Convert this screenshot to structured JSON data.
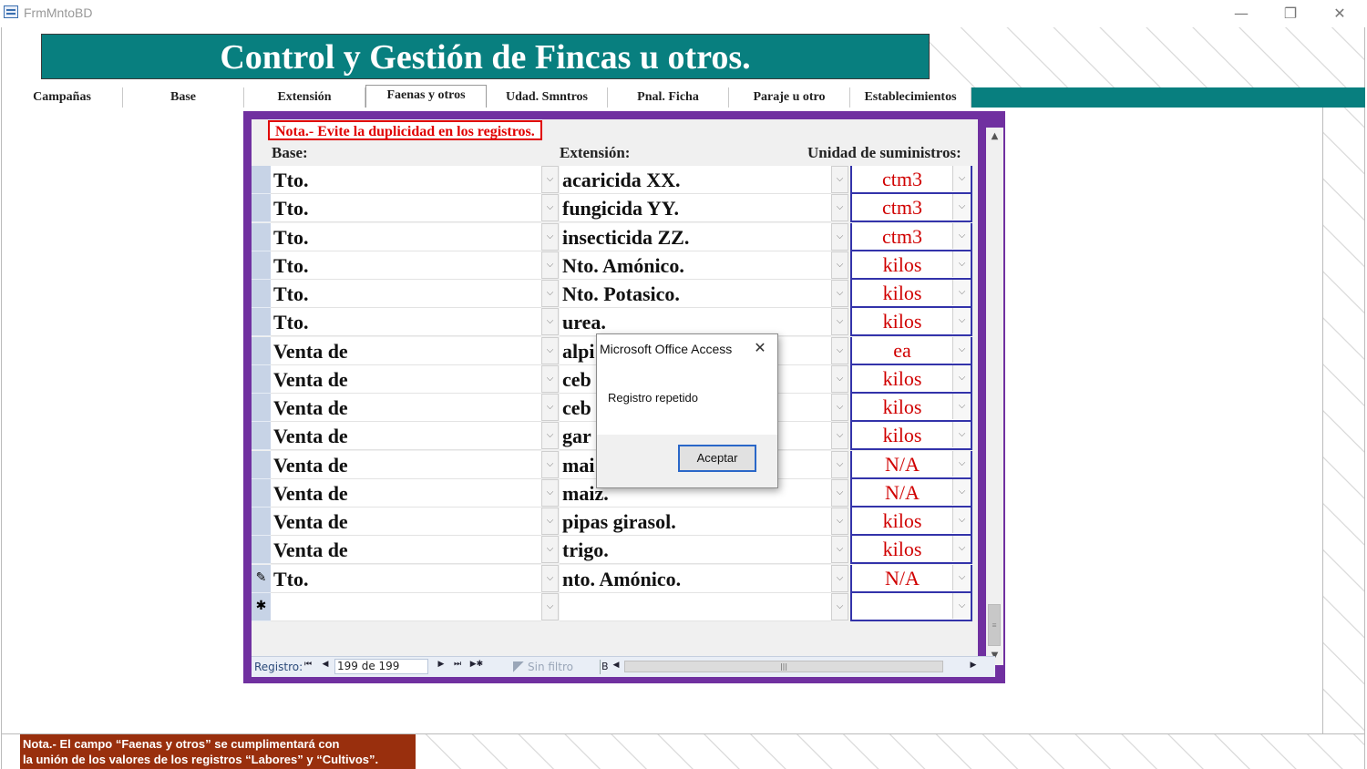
{
  "window": {
    "title": "FrmMntoBD",
    "minimize_glyph": "—",
    "restore_glyph": "❐",
    "close_glyph": "✕"
  },
  "header": {
    "title": "Control y Gestión de Fincas u otros."
  },
  "tabs": [
    {
      "label": "Campañas",
      "active": false
    },
    {
      "label": "Base",
      "active": false
    },
    {
      "label": "Extensión",
      "active": false
    },
    {
      "label": "Faenas y otros",
      "active": true
    },
    {
      "label": "Udad. Smntros",
      "active": false
    },
    {
      "label": "Pnal. Ficha",
      "active": false
    },
    {
      "label": "Paraje u otro",
      "active": false
    },
    {
      "label": "Establecimientos",
      "active": false
    }
  ],
  "subform": {
    "note": "Nota.- Evite la duplicidad en los registros.",
    "headers": {
      "base": "Base:",
      "extension": "Extensión:",
      "unit": "Unidad de suministros:"
    },
    "rows": [
      {
        "base": "Tto.",
        "extension": "acaricida XX.",
        "unit": "ctm3",
        "selector": ""
      },
      {
        "base": "Tto.",
        "extension": "fungicida YY.",
        "unit": "ctm3",
        "selector": ""
      },
      {
        "base": "Tto.",
        "extension": "insecticida ZZ.",
        "unit": "ctm3",
        "selector": ""
      },
      {
        "base": "Tto.",
        "extension": "Nto. Amónico.",
        "unit": "kilos",
        "selector": ""
      },
      {
        "base": "Tto.",
        "extension": "Nto. Potasico.",
        "unit": "kilos",
        "selector": ""
      },
      {
        "base": "Tto.",
        "extension": "urea.",
        "unit": "kilos",
        "selector": ""
      },
      {
        "base": "Venta de",
        "extension": "alpi",
        "unit": "ea",
        "selector": ""
      },
      {
        "base": "Venta de",
        "extension": "ceb",
        "unit": "kilos",
        "selector": ""
      },
      {
        "base": "Venta de",
        "extension": "ceb",
        "unit": "kilos",
        "selector": ""
      },
      {
        "base": "Venta de",
        "extension": "gar",
        "unit": "kilos",
        "selector": ""
      },
      {
        "base": "Venta de",
        "extension": "mai",
        "unit": "N/A",
        "selector": ""
      },
      {
        "base": "Venta de",
        "extension": "maiz.",
        "unit": "N/A",
        "selector": ""
      },
      {
        "base": "Venta de",
        "extension": "pipas girasol.",
        "unit": "kilos",
        "selector": ""
      },
      {
        "base": "Venta de",
        "extension": "trigo.",
        "unit": "kilos",
        "selector": ""
      },
      {
        "base": "Tto.",
        "extension": "nto. Amónico.",
        "unit": "N/A",
        "selector": "✎"
      },
      {
        "base": "",
        "extension": "",
        "unit": "",
        "selector": "✱"
      }
    ],
    "dropdown_glyph": "⌵"
  },
  "navigation": {
    "label": "Registro:",
    "first": "⏮",
    "prev": "◀",
    "record": "199 de 199",
    "next": "▶",
    "last": "⏭",
    "new": "▶✱",
    "filter": "Sin filtro",
    "search_stub": "B"
  },
  "dialog": {
    "title": "Microsoft Office Access",
    "message": "Registro repetido",
    "ok_label": "Aceptar",
    "close_glyph": "✕"
  },
  "footer_note": {
    "line1": "Nota.- El campo “Faenas y otros” se cumplimentará con",
    "line2": "la unión de los valores de los registros “Labores” y “Cultivos”."
  }
}
